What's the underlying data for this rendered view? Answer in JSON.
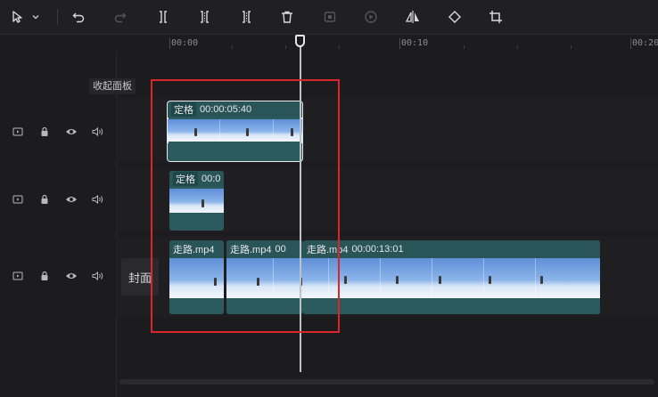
{
  "toolbar": {
    "icons": [
      "select-arrow-icon",
      "chevron-down-icon",
      "undo-icon",
      "redo-icon",
      "split-icon",
      "split-left-icon",
      "split-right-icon",
      "delete-icon",
      "freeze-icon",
      "play-circle-icon",
      "mirror-icon",
      "rotate-icon",
      "crop-icon"
    ]
  },
  "ruler": {
    "labels": [
      "00:00",
      "00:10",
      "00:20"
    ]
  },
  "panel": {
    "collapse_label": "收起面板"
  },
  "tracks": [
    {
      "clips": [
        {
          "tag": "定格",
          "timecode": "00:00:05:40"
        }
      ]
    },
    {
      "clips": [
        {
          "tag": "定格",
          "timecode": "00:0"
        }
      ]
    },
    {
      "cover_label": "封面",
      "clips": [
        {
          "name": "走路.mp4"
        },
        {
          "name": "走路.mp4",
          "timecode": "00"
        },
        {
          "name": "走路.mp4",
          "timecode": "00:00:13:01"
        }
      ]
    }
  ]
}
